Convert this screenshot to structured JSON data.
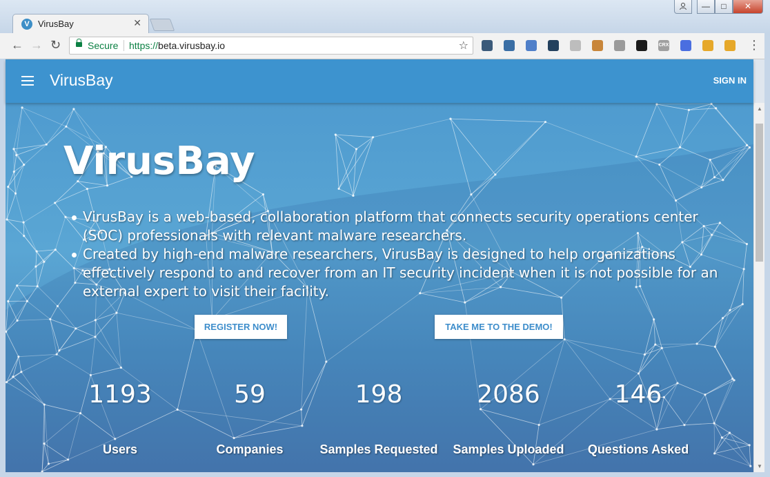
{
  "browser": {
    "tab_title": "VirusBay",
    "tab_favicon": "V",
    "tab_close": "✕",
    "security_label": "Secure",
    "url_scheme": "https://",
    "url_host": "beta.virusbay.io",
    "window_controls": {
      "minimize": "—",
      "maximize": "□",
      "close": "✕"
    },
    "extension_icons": [
      {
        "name": "eyedropper-icon",
        "color": "#3b5a7a"
      },
      {
        "name": "flame-icon",
        "color": "#3a6ea5"
      },
      {
        "name": "calendar-icon",
        "color": "#4f7fc9"
      },
      {
        "name": "camera-icon",
        "color": "#23415e"
      },
      {
        "name": "info-icon",
        "color": "#bdbdbd"
      },
      {
        "name": "lock-extension-icon",
        "color": "#c8863a"
      },
      {
        "name": "pin-icon",
        "color": "#9a9a9a"
      },
      {
        "name": "target-icon",
        "color": "#1b1b1b"
      },
      {
        "name": "crx-icon",
        "color": "#a0a0a0",
        "text": "CRX"
      },
      {
        "name": "check-icon",
        "color": "#4a6ee0"
      },
      {
        "name": "window-icon",
        "color": "#e6a82a"
      },
      {
        "name": "edit-icon",
        "color": "#e6a82a"
      }
    ]
  },
  "appbar": {
    "brand": "VirusBay",
    "sign_in": "SIGN IN"
  },
  "hero": {
    "title": "VirusBay",
    "bullets": [
      "VirusBay is a web-based, collaboration platform that connects security operations center (SOC) professionals with relevant malware researchers.",
      "Created by high-end malware researchers, VirusBay is designed to help organizations effectively respond to and recover from an IT security incident when it is not possible for an external expert to visit their facility."
    ],
    "register_label": "REGISTER NOW!",
    "demo_label": "TAKE ME TO THE DEMO!"
  },
  "stats": [
    {
      "value": "1193",
      "label": "Users"
    },
    {
      "value": "59",
      "label": "Companies"
    },
    {
      "value": "198",
      "label": "Samples Requested"
    },
    {
      "value": "2086",
      "label": "Samples Uploaded"
    },
    {
      "value": "146",
      "label": "Questions Asked"
    }
  ]
}
